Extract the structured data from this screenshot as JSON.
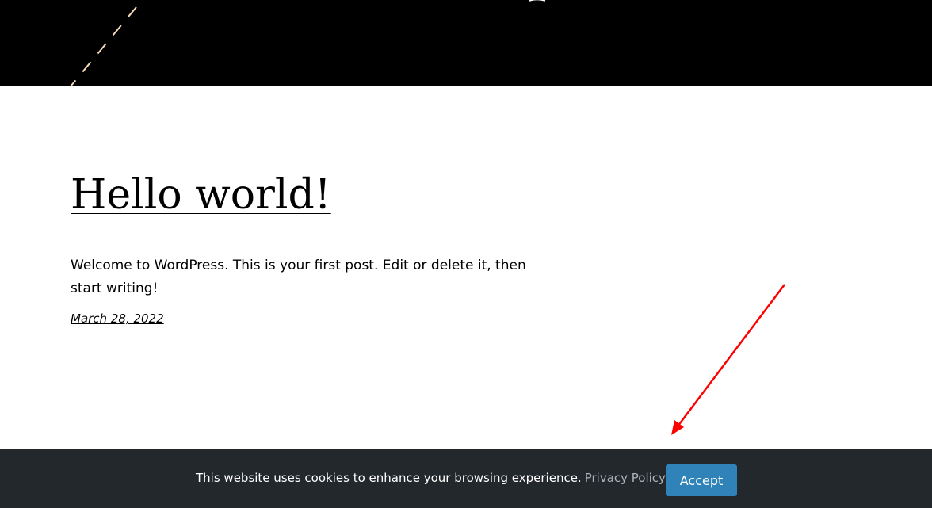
{
  "post": {
    "title": "Hello world!",
    "excerpt": "Welcome to WordPress. This is your first post. Edit or delete it, then start writing!",
    "date": "March 28, 2022"
  },
  "cookie_notice": {
    "message": "This website uses cookies to enhance your browsing experience.",
    "privacy_link": "Privacy Policy",
    "accept_label": "Accept"
  },
  "colors": {
    "header_background": "#000000",
    "header_dash": "#f5d9b8",
    "cookie_bar_background": "#23282d",
    "accept_button": "#2f83b8",
    "annotation_arrow": "#ff0000"
  }
}
